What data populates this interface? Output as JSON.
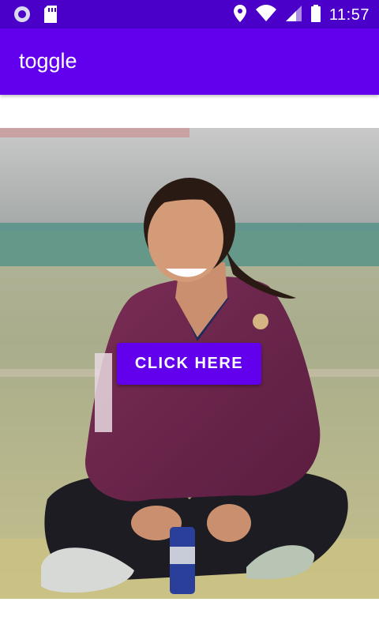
{
  "status_bar": {
    "time": "11:57",
    "background": "#4a00c8",
    "icons": [
      "assistant-icon",
      "sd-card-icon",
      "location-icon",
      "wifi-icon",
      "signal-icon",
      "battery-icon"
    ]
  },
  "app_bar": {
    "title": "toggle",
    "background": "#6200ee"
  },
  "image": {
    "subject": "woman-sitting-on-cricket-field-photo"
  },
  "button": {
    "label": "CLICK HERE",
    "background": "#6200ee"
  }
}
